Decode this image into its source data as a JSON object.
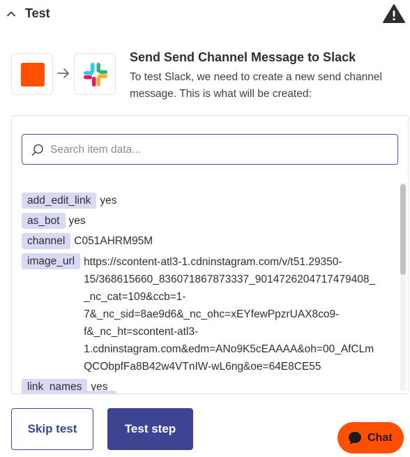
{
  "header": {
    "title": "Test",
    "collapse_icon": "chevron-up-icon",
    "warning_icon": "warning-triangle-icon"
  },
  "step": {
    "source_icon": "zapier-orange-square-icon",
    "arrow_icon": "arrow-right-icon",
    "target_icon": "slack-logo-icon",
    "title": "Send Send Channel Message to Slack",
    "description": "To test Slack, we need to create a new send channel message. This is what will be created:"
  },
  "search": {
    "placeholder": "Search item data...",
    "icon": "search-icon"
  },
  "fields": [
    {
      "key": "add_edit_link",
      "value": "yes"
    },
    {
      "key": "as_bot",
      "value": "yes"
    },
    {
      "key": "channel",
      "value": "C051AHRM95M"
    },
    {
      "key": "image_url",
      "value": "https://scontent-atl3-1.cdninstagram.com/v/t51.29350-\n15/368615660_836071867873337_90147262047174794​08_\n_nc_cat=109&ccb=1-\n7&_nc_sid=8ae9d6&_nc_ohc=xEYfewPpzrUAX8co9-\nf&_nc_ht=scontent-atl3-\n1.cdninstagram.com&edm=ANo9K5cEAAAA&oh=00_AfCLm\nQCObpfFa8B42w4VTnIW-wL6ng&oe=64E8CE55"
    },
    {
      "key": "link_names",
      "value": "yes"
    }
  ],
  "buttons": {
    "skip": "Skip test",
    "test": "Test step"
  },
  "chat": {
    "label": "Chat",
    "icon": "chat-bubble-icon"
  },
  "colors": {
    "accent": "#3d4592",
    "brand_orange": "#ff4f00",
    "key_bg": "#d7d9f5"
  }
}
